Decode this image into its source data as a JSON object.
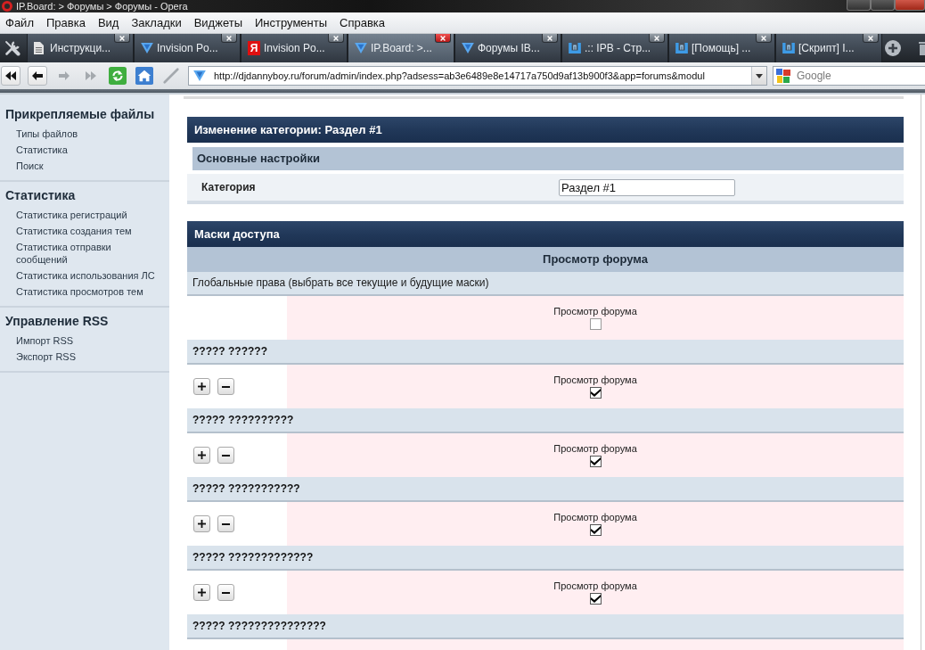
{
  "window": {
    "title": "IP.Board: > Форумы > Форумы - Opera"
  },
  "menu": [
    "Файл",
    "Правка",
    "Вид",
    "Закладки",
    "Виджеты",
    "Инструменты",
    "Справка"
  ],
  "tabs": [
    {
      "kind": "document",
      "label": "Инструкци...",
      "selected": false
    },
    {
      "kind": "triangle",
      "label": "Invision Po...",
      "selected": false
    },
    {
      "kind": "letter",
      "icon_text": "Я",
      "label": "Invision Po...",
      "selected": false
    },
    {
      "kind": "triangle",
      "label": "IP.Board: >...",
      "selected": true
    },
    {
      "kind": "triangle",
      "label": "Форумы IB...",
      "selected": false
    },
    {
      "kind": "bracket",
      "label": ".:: IPB - Стр...",
      "selected": false
    },
    {
      "kind": "bracket",
      "label": "[Помощь] ...",
      "selected": false
    },
    {
      "kind": "bracket",
      "label": "[Скрипт] I...",
      "selected": false
    }
  ],
  "toolbar": [
    {
      "kind": "rewind",
      "disabled": false
    },
    {
      "kind": "back",
      "disabled": false
    },
    {
      "kind": "forward",
      "disabled": true
    },
    {
      "kind": "fast-forward",
      "disabled": true
    },
    {
      "kind": "reload",
      "disabled": false
    },
    {
      "kind": "home",
      "disabled": false
    },
    {
      "kind": "wand",
      "disabled": true
    }
  ],
  "address": {
    "url": "http://djdannyboy.ru/forum/admin/index.php?adsess=ab3e6489e8e14717a750d9af13b900f3&app=forums&modul"
  },
  "search": {
    "placeholder": "Google"
  },
  "sidebar": {
    "sections": [
      {
        "title": "Прикрепляемые файлы",
        "items": [
          "Типы файлов",
          "Статистика",
          "Поиск"
        ]
      },
      {
        "title": "Статистика",
        "items": [
          "Статистика регистраций",
          "Статистика создания тем",
          "Статистика отправки сообщений",
          "Статистика использования ЛС",
          "Статистика просмотров тем"
        ]
      },
      {
        "title": "Управление RSS",
        "items": [
          "Импорт RSS",
          "Экспорт RSS"
        ]
      }
    ]
  },
  "category_form": {
    "title": "Изменение категории: Раздел #1",
    "subheader": "Основные настройки",
    "fields": [
      {
        "label": "Категория",
        "value": "Раздел #1"
      }
    ]
  },
  "permissions": {
    "title": "Маски доступа",
    "column": "Просмотр форума",
    "global": {
      "label": "Глобальные права (выбрать все текущие и будущие маски)",
      "option": "Просмотр форума",
      "checked": false
    },
    "masks": [
      {
        "name": "????? ??????",
        "option": "Просмотр форума",
        "checked": true
      },
      {
        "name": "????? ??????????",
        "option": "Просмотр форума",
        "checked": true
      },
      {
        "name": "????? ???????????",
        "option": "Просмотр форума",
        "checked": true
      },
      {
        "name": "????? ?????????????",
        "option": "Просмотр форума",
        "checked": true
      },
      {
        "name": "????? ???????????????"
      }
    ]
  }
}
